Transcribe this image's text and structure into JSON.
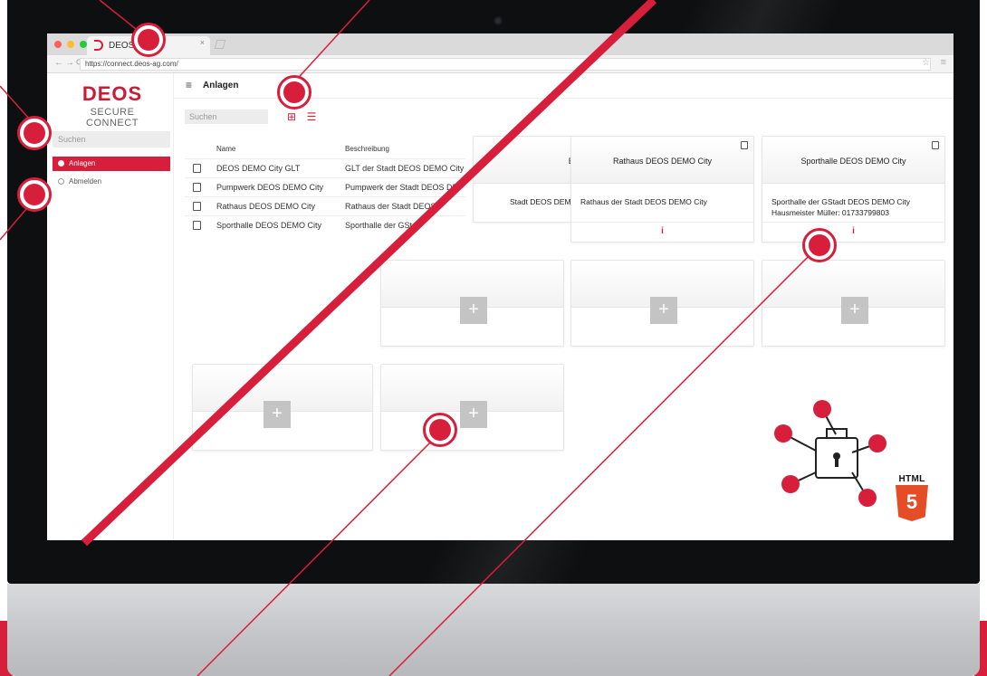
{
  "browser": {
    "tab_title": "DEOS",
    "tab_close": "×",
    "url": "https://connect.deos-ag.com/",
    "traffic_light_colors": [
      "#ff5f57",
      "#febc2e",
      "#28c840"
    ]
  },
  "brand": {
    "name": "DEOS",
    "subtitle": "SECURE CONNECT",
    "accent_color": "#d71f3c"
  },
  "sidebar": {
    "search_placeholder": "Suchen",
    "items": [
      {
        "label": "Anlagen",
        "active": true
      },
      {
        "label": "Abmelden",
        "active": false
      }
    ]
  },
  "header": {
    "title": "Anlagen"
  },
  "main": {
    "search_placeholder": "Suchen",
    "view_icons": [
      "grid-view-icon",
      "list-view-icon"
    ]
  },
  "table": {
    "columns": [
      "Name",
      "Beschreibung"
    ],
    "rows": [
      {
        "name": "DEOS DEMO City GLT",
        "description": "GLT der Stadt DEOS DEMO City"
      },
      {
        "name": "Pumpwerk DEOS DEMO City",
        "description": "Pumpwerk der Stadt DEOS DE"
      },
      {
        "name": "Rathaus DEOS DEMO City",
        "description": "Rathaus der Stadt DEOS"
      },
      {
        "name": "Sporthalle DEOS DEMO City",
        "description": "Sporthalle der GSta"
      }
    ]
  },
  "cards": [
    {
      "title": "EMO City",
      "description": "Stadt DEOS DEMO City",
      "description2": "",
      "info": ""
    },
    {
      "title": "Rathaus DEOS DEMO City",
      "description": "Rathaus der Stadt DEOS DEMO City",
      "description2": "",
      "info": "i"
    },
    {
      "title": "Sporthalle DEOS DEMO City",
      "description": "Sporthalle der GStadt DEOS DEMO City",
      "description2": "Hausmeister Müller: 01733799803",
      "info": "i"
    }
  ],
  "add_cards": {
    "plus_label": "+"
  },
  "badge": {
    "label": "HTML",
    "number": "5"
  }
}
